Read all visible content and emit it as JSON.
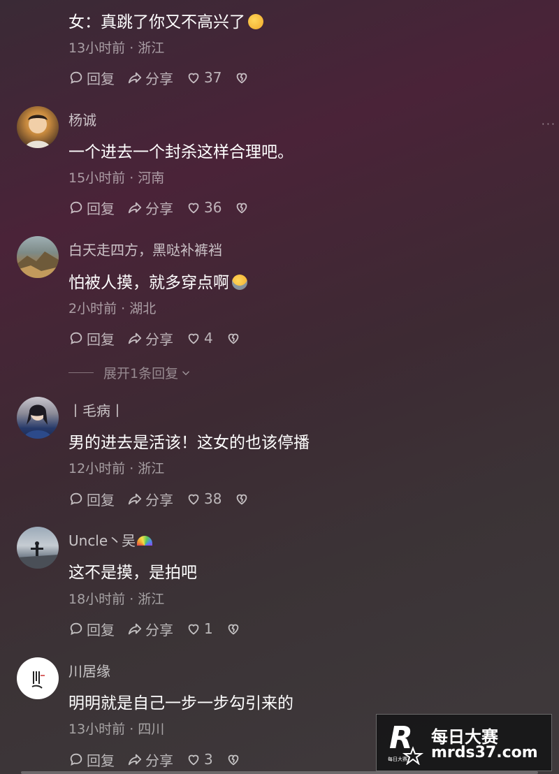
{
  "comments": [
    {
      "name": "",
      "text": "女：真跳了你又不高兴了",
      "emoji": "thinking-emoji",
      "meta": "13小时前 · 浙江",
      "reply": "回复",
      "share": "分享",
      "likes": "37"
    },
    {
      "name": "杨诚",
      "text": "一个进去一个封杀这样合理吧。",
      "meta": "15小时前 · 河南",
      "reply": "回复",
      "share": "分享",
      "likes": "36"
    },
    {
      "name": "白天走四方，黑哒补裤裆",
      "text": "怕被人摸，就多穿点啊",
      "emoji": "rofl-emoji",
      "meta": "2小时前 · 湖北",
      "reply": "回复",
      "share": "分享",
      "likes": "4",
      "expand": "展开1条回复"
    },
    {
      "name": "丨毛病丨",
      "text": "男的进去是活该！这女的也该停播",
      "meta": "12小时前 · 浙江",
      "reply": "回复",
      "share": "分享",
      "likes": "38"
    },
    {
      "name": "Uncle丶吴",
      "name_emoji": "rainbow-emoji",
      "text": "这不是摸，是拍吧",
      "meta": "18小时前 · 浙江",
      "reply": "回复",
      "share": "分享",
      "likes": "1"
    },
    {
      "name": "川居缘",
      "text": "明明就是自己一步一步勾引来的",
      "meta": "13小时前 · 四川",
      "reply": "回复",
      "share": "分享",
      "likes": "3"
    }
  ],
  "more_label": "···",
  "watermark": {
    "logo_letter": "R",
    "logo_caption": "每日大赛",
    "title": "每日大赛",
    "site": "mrds37.com"
  },
  "icons": {
    "reply": "comment-bubble-icon",
    "share": "share-arrow-icon",
    "like": "heart-icon",
    "dislike": "broken-heart-icon"
  }
}
